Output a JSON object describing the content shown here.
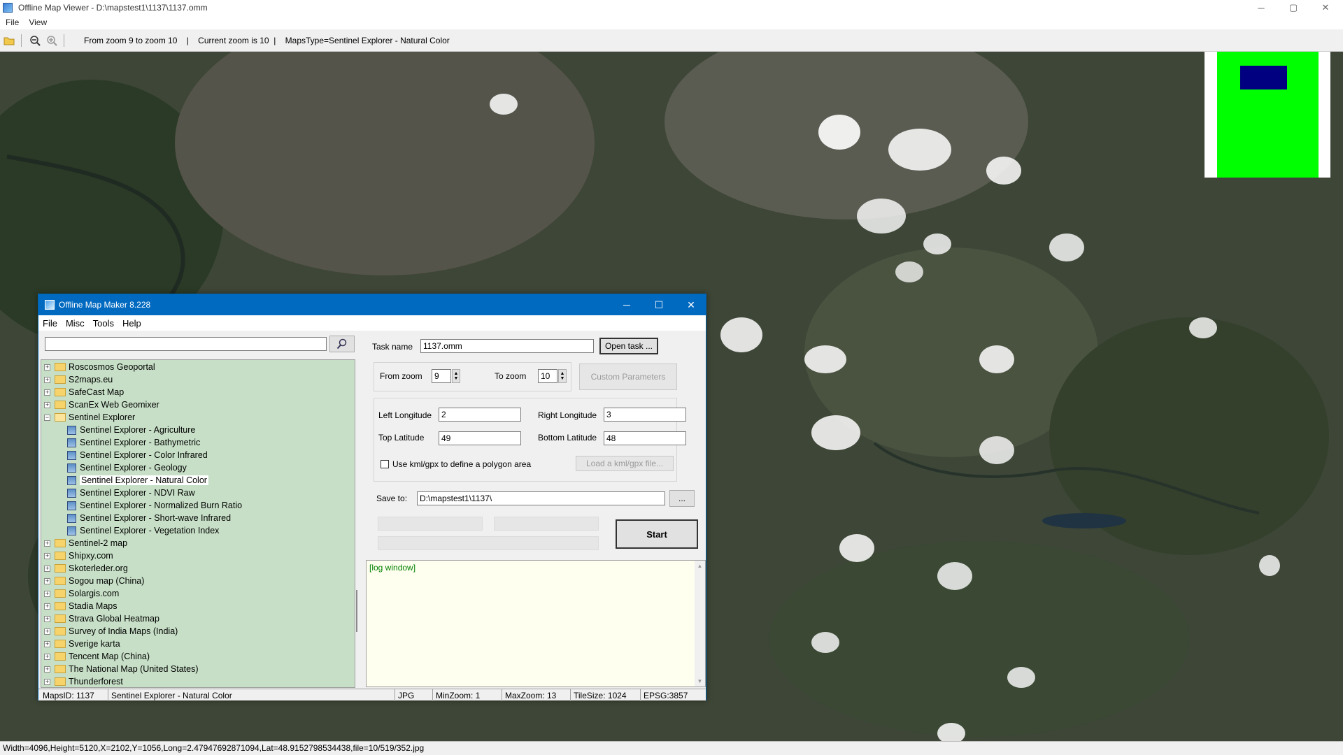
{
  "window": {
    "title": "Offline Map Viewer - D:\\mapstest1\\1137\\1137.omm",
    "minimize": "─",
    "maximize": "▢",
    "close": "✕"
  },
  "menu": {
    "file": "File",
    "view": "View"
  },
  "toolbar": {
    "info": "From zoom 9 to zoom 10    |    Current zoom is 10  |    MapsType=Sentinel Explorer - Natural Color"
  },
  "status": {
    "text": "Width=4096,Height=5120,X=2102,Y=1056,Long=2.47947692871094,Lat=48.9152798534438,file=10/519/352.jpg"
  },
  "dialog": {
    "title": "Offline Map Maker 8.228",
    "menu": [
      "File",
      "Misc",
      "Tools",
      "Help"
    ],
    "search": {
      "value": "",
      "icon": "search-icon"
    },
    "task_name_label": "Task name",
    "task_name": "1137.omm",
    "open_task": "Open task ...",
    "from_zoom_label": "From zoom",
    "from_zoom": "9",
    "to_zoom_label": "To zoom",
    "to_zoom": "10",
    "custom_params": "Custom Parameters",
    "left_lon_label": "Left Longitude",
    "left_lon": "2",
    "right_lon_label": "Right Longitude",
    "right_lon": "3",
    "top_lat_label": "Top Latitude",
    "top_lat": "49",
    "bottom_lat_label": "Bottom Latitude",
    "bottom_lat": "48",
    "kml_label": "Use kml/gpx to define a polygon area",
    "kml_checked": false,
    "load_kml": "Load a kml/gpx file...",
    "save_to_label": "Save to:",
    "save_to": "D:\\mapstest1\\1137\\",
    "browse": "...",
    "start": "Start",
    "log": "[log window]",
    "tree": [
      {
        "label": "Roscosmos Geoportal",
        "kind": "folder",
        "exp": "+"
      },
      {
        "label": "S2maps.eu",
        "kind": "folder",
        "exp": "+"
      },
      {
        "label": "SafeCast Map",
        "kind": "folder",
        "exp": "+"
      },
      {
        "label": "ScanEx Web Geomixer",
        "kind": "folder",
        "exp": "+"
      },
      {
        "label": "Sentinel Explorer",
        "kind": "folder-open",
        "exp": "−"
      },
      {
        "label": "Sentinel Explorer - Agriculture",
        "kind": "map"
      },
      {
        "label": "Sentinel Explorer - Bathymetric",
        "kind": "map"
      },
      {
        "label": "Sentinel Explorer - Color Infrared",
        "kind": "map"
      },
      {
        "label": "Sentinel Explorer - Geology",
        "kind": "map"
      },
      {
        "label": "Sentinel Explorer - Natural Color",
        "kind": "map",
        "selected": true
      },
      {
        "label": "Sentinel Explorer - NDVI Raw",
        "kind": "map"
      },
      {
        "label": "Sentinel Explorer - Normalized Burn Ratio",
        "kind": "map"
      },
      {
        "label": "Sentinel Explorer - Short-wave Infrared",
        "kind": "map"
      },
      {
        "label": "Sentinel Explorer - Vegetation Index",
        "kind": "map"
      },
      {
        "label": "Sentinel-2 map",
        "kind": "folder",
        "exp": "+"
      },
      {
        "label": "Shipxy.com",
        "kind": "folder",
        "exp": "+"
      },
      {
        "label": "Skoterleder.org",
        "kind": "folder",
        "exp": "+"
      },
      {
        "label": "Sogou map (China)",
        "kind": "folder",
        "exp": "+"
      },
      {
        "label": "Solargis.com",
        "kind": "folder",
        "exp": "+"
      },
      {
        "label": "Stadia Maps",
        "kind": "folder",
        "exp": "+"
      },
      {
        "label": "Strava Global Heatmap",
        "kind": "folder",
        "exp": "+"
      },
      {
        "label": "Survey of India Maps (India)",
        "kind": "folder",
        "exp": "+"
      },
      {
        "label": "Sverige karta",
        "kind": "folder",
        "exp": "+"
      },
      {
        "label": "Tencent Map (China)",
        "kind": "folder",
        "exp": "+"
      },
      {
        "label": "The National Map (United States)",
        "kind": "folder",
        "exp": "+"
      },
      {
        "label": "Thunderforest",
        "kind": "folder",
        "exp": "+"
      }
    ],
    "statusbar": {
      "maps_id": "MapsID: 1137",
      "maps_name": "Sentinel Explorer - Natural Color",
      "format": "JPG",
      "min_zoom": "MinZoom: 1",
      "max_zoom": "MaxZoom: 13",
      "tile_size": "TileSize: 1024",
      "epsg": "EPSG:3857"
    }
  }
}
